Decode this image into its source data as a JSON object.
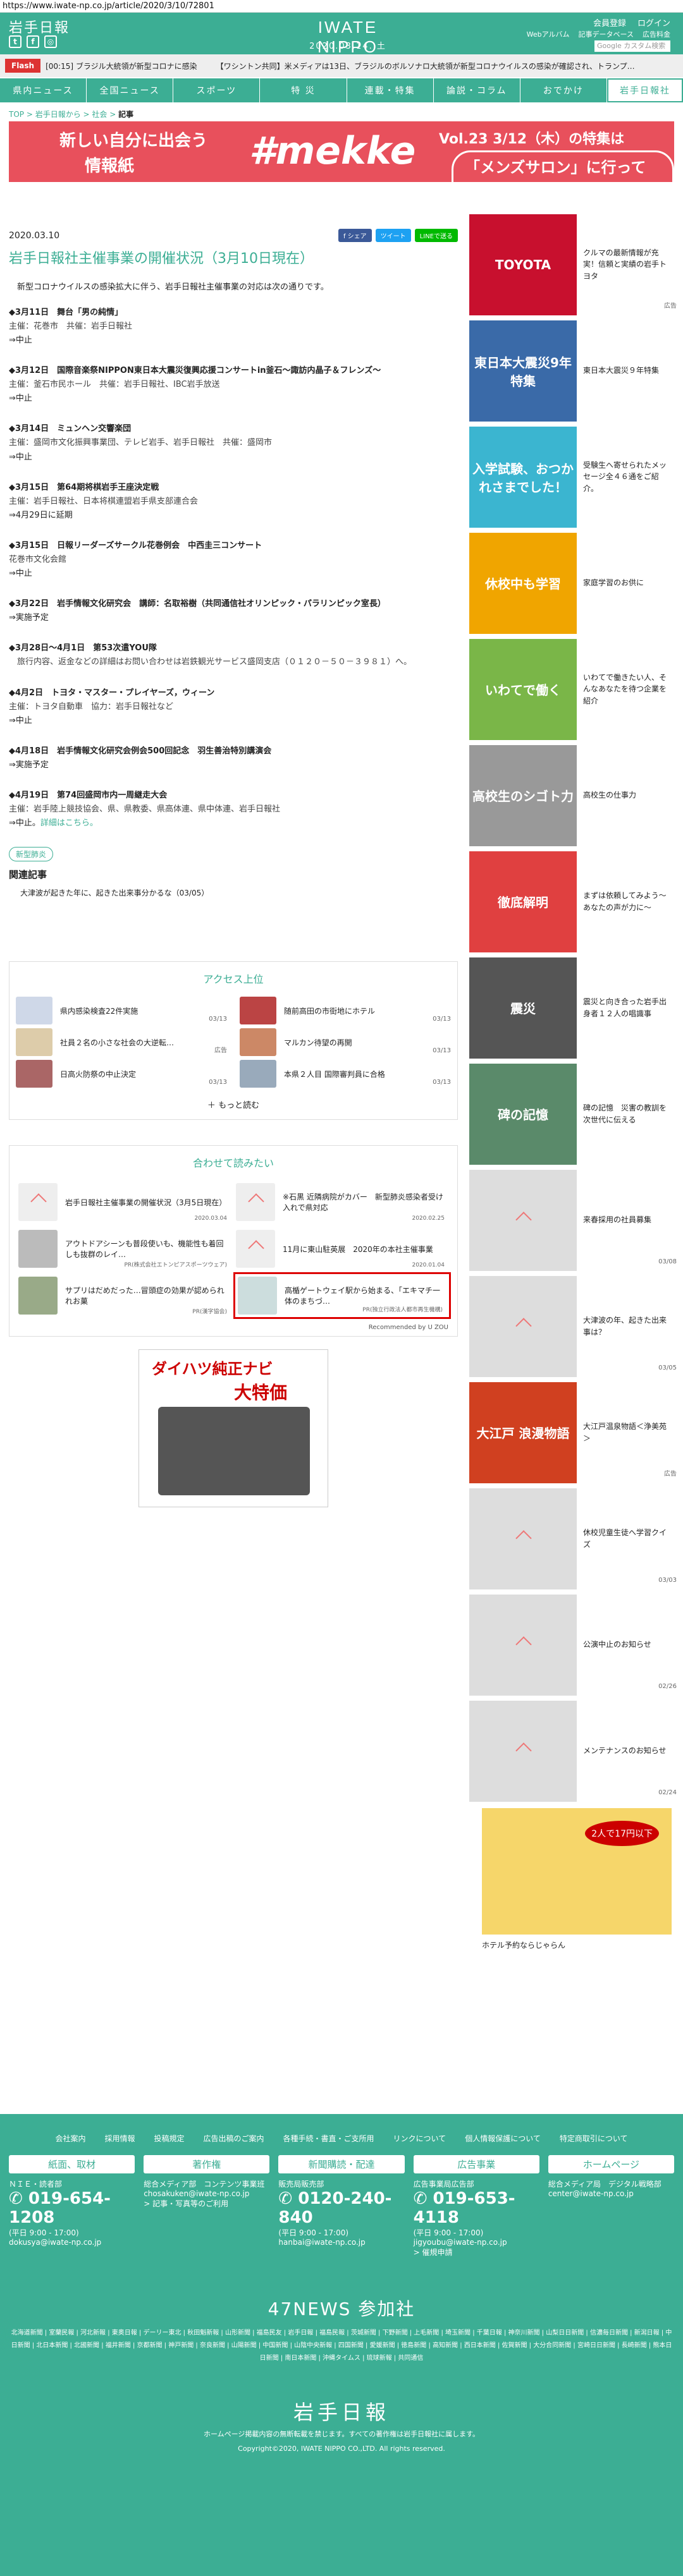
{
  "url": "https://www.iwate-np.co.jp/article/2020/3/10/72801",
  "header": {
    "logo": "岩手日報",
    "brand": "IWATE NIPPO",
    "date": "2020.03.14. 土",
    "toplinks": [
      "会員登録",
      "ログイン"
    ],
    "sublinks": [
      "Webアルバム",
      "記事データベース",
      "広告料金"
    ],
    "search_placeholder": "Google カスタム検索"
  },
  "flash": {
    "tag": "Flash",
    "items": [
      "[00:15] ブラジル大統領が新型コロナに感染",
      "【ワシントン共同】米メディアは13日、ブラジルのボルソナロ大統領が新型コロナウイルスの感染が確認され、トランプ…"
    ]
  },
  "nav": [
    "県内ニュース",
    "全国ニュース",
    "スポーツ",
    "特 災",
    "連載・特集",
    "論説・コラム",
    "おでかけ",
    "岩手日報社"
  ],
  "breadcrumb": [
    "TOP",
    "岩手日報から",
    "社会",
    "記事"
  ],
  "banner": {
    "l1": "新しい自分に出会う",
    "l2": "情報紙",
    "brand": "#mekke",
    "r1": "Vol.23 3/12（木）の特集は",
    "r2": "「メンズサロン」に行ってみた！"
  },
  "article": {
    "date": "2020.03.10",
    "share": [
      "f シェア",
      "ツイート",
      "LINEで送る"
    ],
    "title": "岩手日報社主催事業の開催状況（3月10日現在）",
    "lead": "　新型コロナウイルスの感染拡大に伴う、岩手日報社主催事業の対応は次の通りです。",
    "events": [
      {
        "t": "◆3月11日　舞台「男の純情」",
        "s": "主催：花巻市　共催：岩手日報社",
        "r": "⇒中止"
      },
      {
        "t": "◆3月12日　国際音楽祭NIPPON東日本大震災復興応援コンサートin釜石～諏訪内晶子＆フレンズ～",
        "s": "主催：釜石市民ホール　共催：岩手日報社、IBC岩手放送",
        "r": "⇒中止"
      },
      {
        "t": "◆3月14日　ミュンヘン交響楽団",
        "s": "主催：盛岡市文化振興事業団、テレビ岩手、岩手日報社　共催：盛岡市",
        "r": "⇒中止"
      },
      {
        "t": "◆3月15日　第64期将棋岩手王座決定戦",
        "s": "主催：岩手日報社、日本将棋連盟岩手県支部連合会",
        "r": "⇒4月29日に延期"
      },
      {
        "t": "◆3月15日　日報リーダーズサークル花巻例会　中西圭三コンサート",
        "s": "花巻市文化会館",
        "r": "⇒中止"
      },
      {
        "t": "◆3月22日　岩手情報文化研究会　講師：名取裕樹（共同通信社オリンピック・パラリンピック室長）",
        "s": "",
        "r": "⇒実施予定"
      },
      {
        "t": "◆3月28日～4月1日　第53次遣YOU隊",
        "s": "　旅行内容、返金などの詳細はお問い合わせは岩鉄観光サービス盛岡支店（０１２０－５０－３９８１）へ。",
        "r": ""
      },
      {
        "t": "◆4月2日　トヨタ・マスター・プレイヤーズ，ウィーン",
        "s": "主催：トヨタ自動車　協力：岩手日報社など",
        "r": "⇒中止"
      },
      {
        "t": "◆4月18日　岩手情報文化研究会例会500回記念　羽生善治特別講演会",
        "s": "",
        "r": "⇒実施予定"
      },
      {
        "t": "◆4月19日　第74回盛岡市内一周継走大会",
        "s": "主催：岩手陸上競技協会、県、県教委、県高体連、県中体連、岩手日報社",
        "r": "⇒中止。",
        "link": "詳細はこちら。"
      }
    ],
    "tag": "新型肺炎",
    "rel_title": "関連記事",
    "rel_item": "大津波が起きた年に、起きた出来事分かるな（03/05）"
  },
  "access": {
    "title": "アクセス上位",
    "items": [
      {
        "label": "県内感染検査22件実施",
        "date": "03/13"
      },
      {
        "label": "随前高田の市街地にホテル",
        "date": "03/13"
      },
      {
        "label": "社員２名の小さな社会の大逆転…",
        "date": "広告"
      },
      {
        "label": "マルカン待望の再開",
        "date": "03/13"
      },
      {
        "label": "日高火防祭の中止決定",
        "date": "03/13"
      },
      {
        "label": "本県２人目 国際審判員に合格",
        "date": "03/13"
      }
    ],
    "more": "もっと読む"
  },
  "recommend": {
    "title": "合わせて読みたい",
    "items": [
      {
        "label": "岩手日報社主催事業の開催状況（3月5日現在）",
        "date": "2020.03.04"
      },
      {
        "label": "※石黒 近隣病院がカバー　新型肺炎感染者受け入れで県対応",
        "date": "2020.02.25"
      },
      {
        "label": "アウトドアシーンも普段使いも、機能性も着回しも抜群のレイ…",
        "date": "PR(株式会社エトンピアスポーツウェア)"
      },
      {
        "label": "11月に東山駐英展　2020年の本社主催事業",
        "date": "2020.01.04"
      },
      {
        "label": "サプリはだめだった…冒頭症の効果が認められれお菓",
        "date": "PR(漢字協会)"
      },
      {
        "label": "高楯ゲートウェイ駅から始まる、「エキマチ一体のまちづ…",
        "date": "PR(独立行政法人都市再生機構)"
      }
    ],
    "footer": "Recommended by U ZOU"
  },
  "ad": {
    "l1": "ダイハツ純正ナビ",
    "l2": "大特価"
  },
  "sidebar": [
    {
      "img": "TOYOTA",
      "text": "クルマの最新情報が充実！信頼と実績の岩手トヨタ",
      "date": "広告",
      "color": "#c8102e"
    },
    {
      "img": "東日本大震災9年特集",
      "text": "東日本大震災９年特集",
      "date": "",
      "color": "#3a6aa8"
    },
    {
      "img": "入学試験、おつかれさまでした！",
      "text": "受験生へ寄せられたメッセージ全４６通をご紹介。",
      "date": "",
      "color": "#3bb5d0"
    },
    {
      "img": "休校中も学習",
      "text": "家庭学習のお供に",
      "date": "",
      "color": "#f0a500"
    },
    {
      "img": "いわてで働く",
      "text": "いわてで働きたい人、そんなあなたを待つ企業を紹介",
      "date": "",
      "color": "#7ab648"
    },
    {
      "img": "高校生のシゴト力",
      "text": "高校生の仕事力",
      "date": "",
      "color": "#999"
    },
    {
      "img": "徹底解明",
      "text": "まずは依頼してみよう～あなたの声が力に～",
      "date": "",
      "color": "#e04040"
    },
    {
      "img": "震災",
      "text": "震災と向き合った岩手出身者１２人の唱識事",
      "date": "",
      "color": "#555"
    },
    {
      "img": "碑の記憶",
      "text": "碑の記憶　災害の教訓を次世代に伝える",
      "date": "",
      "color": "#5a8a6a"
    },
    {
      "img": "",
      "text": "来春採用の社員募集",
      "date": "03/08",
      "color": "#ccc"
    },
    {
      "img": "",
      "text": "大津波の年、起きた出来事は？",
      "date": "03/05",
      "color": "#667"
    },
    {
      "img": "大江戸 浪漫物語",
      "text": "大江戸温泉物語＜浄美苑＞",
      "date": "広告",
      "color": "#d04020"
    },
    {
      "img": "",
      "text": "休校児童生徒へ学習クイズ",
      "date": "03/03",
      "color": "#ccc"
    },
    {
      "img": "",
      "text": "公演中止のお知らせ",
      "date": "02/26",
      "color": "#ccc"
    },
    {
      "img": "",
      "text": "メンテナンスのお知らせ",
      "date": "02/24",
      "color": "#ccc"
    }
  ],
  "jalan": {
    "text": "ホテル予約ならじゃらん",
    "badge": "2人で17円以下"
  },
  "footer": {
    "links": [
      "会社案内",
      "採用情報",
      "投稿規定",
      "広告出稿のご案内",
      "各種手続・書直・ご支所用",
      "リンクについて",
      "個人情報保護について",
      "特定商取引について"
    ],
    "cols": [
      {
        "h": "紙面、取材",
        "sub": "ＮＩＥ・読者部",
        "tel": "019-654-1208",
        "hours": "(平日 9:00 - 17:00)",
        "mail": "dokusya@iwate-np.co.jp"
      },
      {
        "h": "著作権",
        "sub": "総合メディア部　コンテンツ事業班",
        "tel": "",
        "hours": "",
        "mail": "chosakuken@iwate-np.co.jp",
        "note": "> 記事・写真等のご利用"
      },
      {
        "h": "新聞購読・配達",
        "sub": "販売局販売部",
        "tel": "0120-240-840",
        "hours": "(平日 9:00 - 17:00)",
        "mail": "hanbai@iwate-np.co.jp"
      },
      {
        "h": "広告事業",
        "sub": "広告事業局広告部",
        "tel": "019-653-4118",
        "hours": "(平日 9:00 - 17:00)",
        "mail": "jigyoubu@iwate-np.co.jp",
        "note": "> 催規申請"
      },
      {
        "h": "ホームページ",
        "sub": "総合メディア局　デジタル戦略部",
        "tel": "",
        "hours": "",
        "mail": "center@iwate-np.co.jp"
      }
    ],
    "n47": "47NEWS 参加社",
    "papers": "北海道新聞 | 室蘭民報 | 河北新報 | 東奥日報 | デーリー東北 | 秋田魁新報 | 山形新聞 | 福島民友 | 岩手日報 | 福島民報 | 茨城新聞 | 下野新聞 | 上毛新聞 | 埼玉新聞 | 千葉日報 | 神奈川新聞 | 山梨日日新聞 | 信濃毎日新聞 | 新潟日報 | 中日新聞 | 北日本新聞 | 北國新聞 | 福井新聞 | 京都新聞 | 神戸新聞 | 奈良新聞 | 山陽新聞 | 中国新聞 | 山陰中央新報 | 四国新聞 | 愛媛新聞 | 徳島新聞 | 高知新聞 | 西日本新聞 | 佐賀新聞 | 大分合同新聞 | 宮崎日日新聞 | 長崎新聞 | 熊本日日新聞 | 南日本新聞 | 沖縄タイムス | 琉球新報 | 共同通信",
    "logo": "岩手日報",
    "notice": "ホームページ掲載内容の無断転載を禁じます。すべての著作権は岩手日報社に属します。",
    "copy": "Copyright©2020, IWATE NIPPO CO.,LTD. All rights reserved."
  }
}
